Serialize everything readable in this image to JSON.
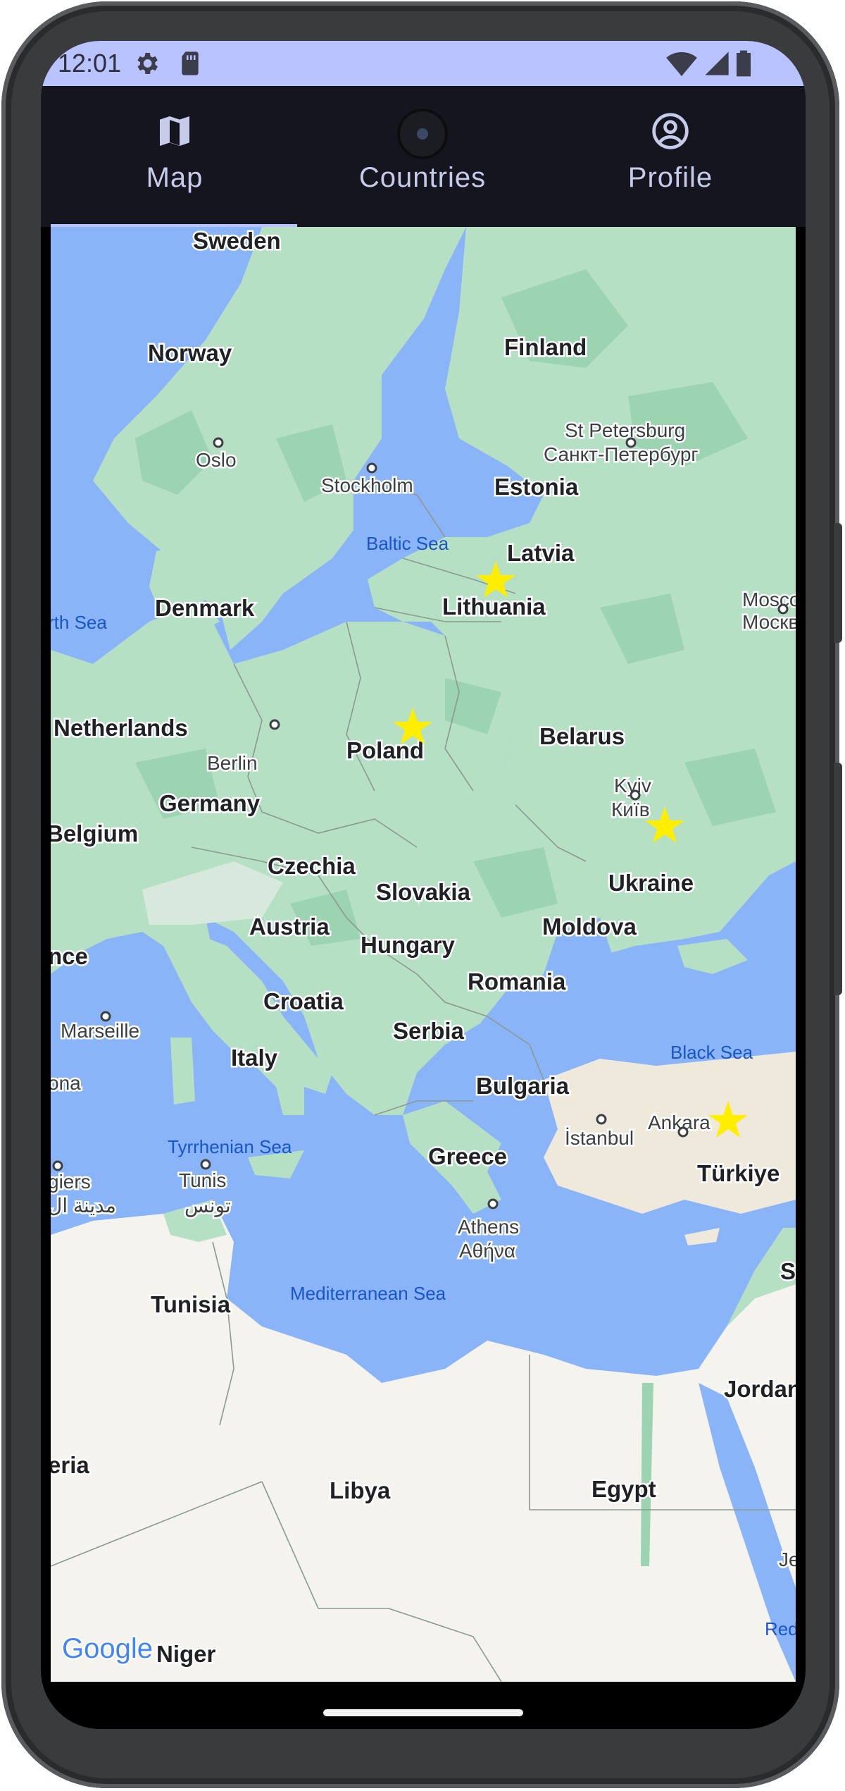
{
  "status_bar": {
    "time": "12:01",
    "icons": [
      "gear-icon",
      "sim-card-icon",
      "wifi-icon",
      "cell-signal-icon",
      "battery-icon"
    ]
  },
  "tabs": [
    {
      "label": "Map",
      "icon": "map-icon",
      "selected": true
    },
    {
      "label": "Countries",
      "icon": "search-icon",
      "selected": false
    },
    {
      "label": "Profile",
      "icon": "account-circle-icon",
      "selected": false
    }
  ],
  "colors": {
    "accent": "#b9c3ff",
    "app_bar": "#151520",
    "water": "#8ab4f8",
    "land": "#b6e0c4",
    "forest": "#9cd3b0",
    "desert": "#f5f3ee",
    "star": "#ffee00"
  },
  "map": {
    "countries": [
      "Sweden",
      "Norway",
      "Finland",
      "Estonia",
      "Latvia",
      "Lithuania",
      "Denmark",
      "Netherlands",
      "Belarus",
      "Poland",
      "Germany",
      "Belgium",
      "Czechia",
      "Slovakia",
      "Ukraine",
      "Austria",
      "Moldova",
      "Hungary",
      "Romania",
      "Croatia",
      "Serbia",
      "Italy",
      "Bulgaria",
      "Greece",
      "Türkiye",
      "Tunisia",
      "Libya",
      "Egypt",
      "Jordan",
      "Niger",
      "nce",
      "eria",
      "S"
    ],
    "cities": [
      "Oslo",
      "Stockholm",
      "St Petersburg",
      "Санкт-Петербург",
      "Moscow",
      "Москва",
      "Berlin",
      "Kyiv",
      "Київ",
      "Marseille",
      "ona",
      "Tunis",
      "تونس",
      "giers",
      "مدينة ال",
      "İstanbul",
      "Ankara",
      "Athens",
      "Αθήνα",
      "Je"
    ],
    "seas": [
      "Baltic Sea",
      "rth Sea",
      "Black Sea",
      "Tyrrhenian Sea",
      "Mediterranean Sea",
      "Red"
    ],
    "starred_countries": [
      "Lithuania",
      "Poland",
      "Ukraine",
      "Türkiye"
    ],
    "attribution": "Google"
  }
}
